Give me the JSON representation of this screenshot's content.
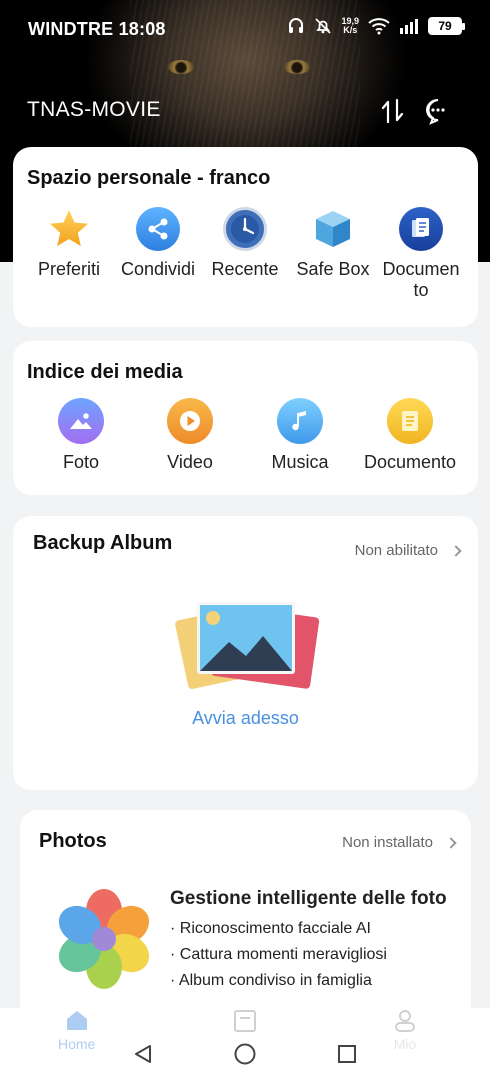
{
  "status_bar": {
    "carrier_time": "WINDTRE 18:08",
    "speed_value": "19,9",
    "speed_unit": "K/s",
    "battery": "79"
  },
  "header": {
    "title": "TNAS-MOVIE"
  },
  "personal_space": {
    "title": "Spazio personale - franco",
    "items": [
      {
        "label": "Preferiti",
        "icon": "star-icon"
      },
      {
        "label": "Condividi",
        "icon": "share-icon"
      },
      {
        "label": "Recente",
        "icon": "clock-icon"
      },
      {
        "label": "Safe Box",
        "icon": "safe-box-icon"
      },
      {
        "label_line1": "Documen",
        "label_line2": "to",
        "icon": "document-icon"
      }
    ]
  },
  "media_index": {
    "title": "Indice dei media",
    "items": [
      {
        "label": "Foto",
        "icon": "photo-icon",
        "color": "#8b7cf2"
      },
      {
        "label": "Video",
        "icon": "play-icon",
        "color": "#f2a23a"
      },
      {
        "label": "Musica",
        "icon": "music-icon",
        "color": "#5ab4f0"
      },
      {
        "label": "Documento",
        "icon": "document-icon",
        "color": "#f4c63a"
      }
    ]
  },
  "backup_album": {
    "title": "Backup Album",
    "status": "Non abilitato",
    "action": "Avvia adesso",
    "action_color": "#4a90e2"
  },
  "photos": {
    "title": "Photos",
    "status": "Non installato",
    "feature_title": "Gestione intelligente delle foto",
    "features": [
      "· Riconoscimento facciale AI",
      "· Cattura momenti meravigliosi",
      "· Album condiviso in famiglia"
    ]
  },
  "bottom_tabs": {
    "home": "Home",
    "mio": "Mio"
  }
}
